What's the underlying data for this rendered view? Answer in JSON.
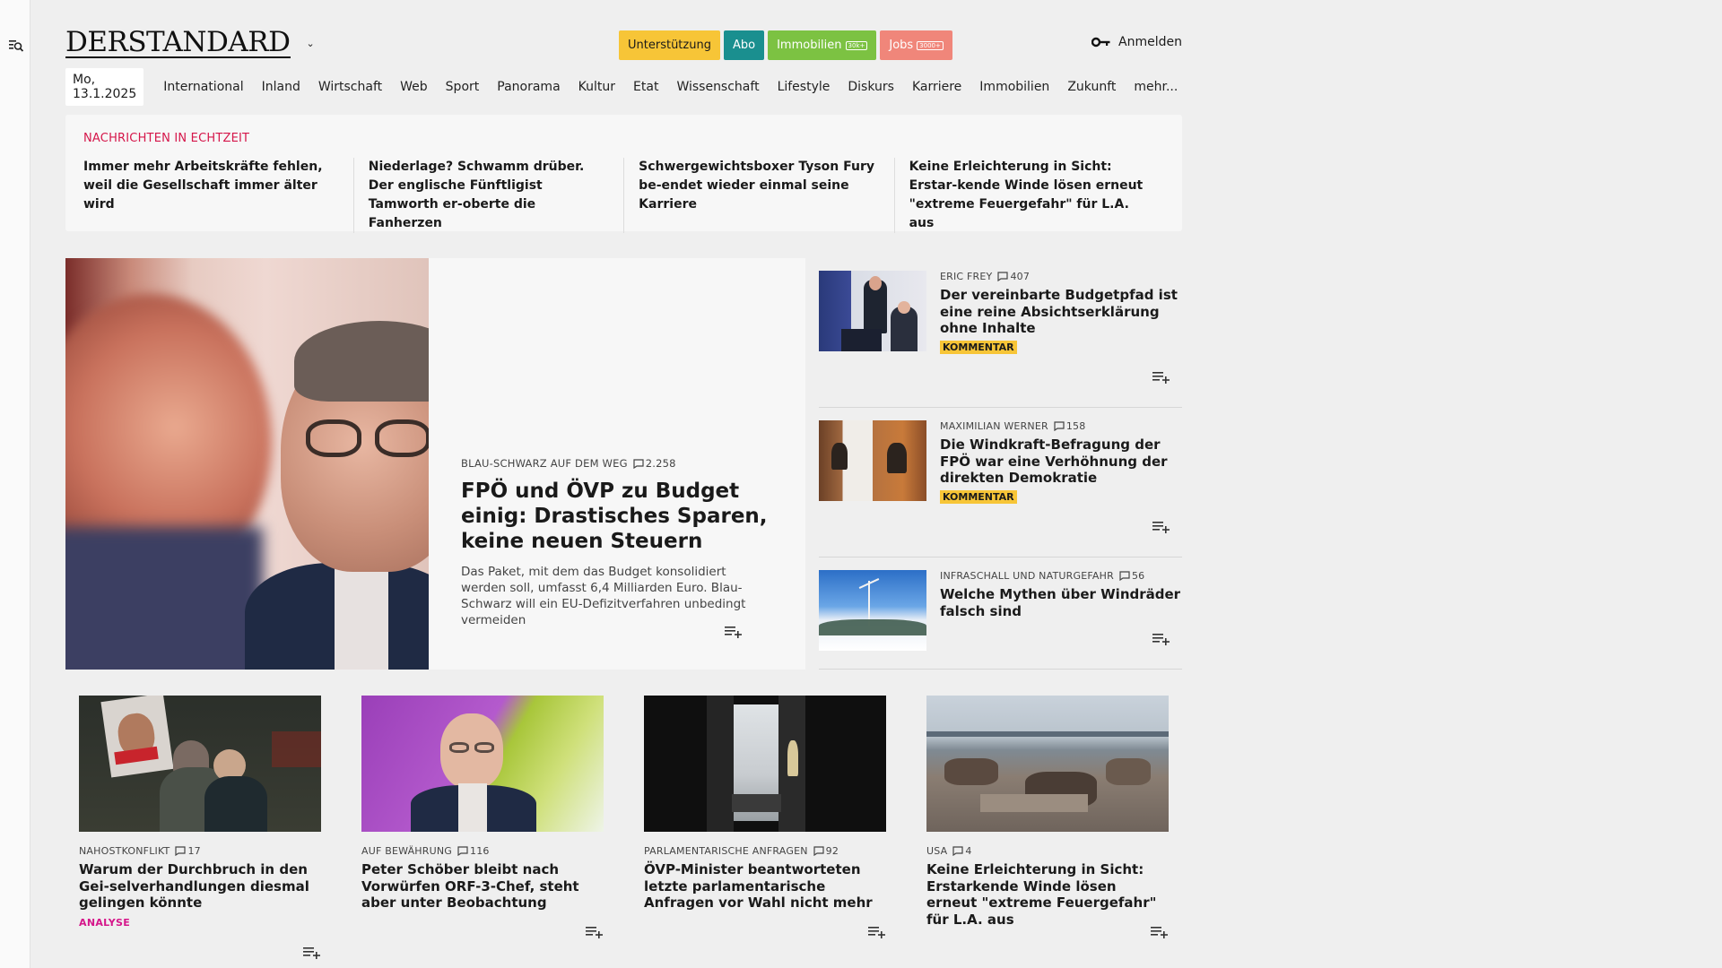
{
  "site": {
    "logo": "DERSTANDARD"
  },
  "header": {
    "badges": [
      {
        "label": "Unterstützung"
      },
      {
        "label": "Abo"
      },
      {
        "label": "Immobilien",
        "tag": "30k+"
      },
      {
        "label": "Jobs",
        "tag": "3000+"
      }
    ],
    "login_label": "Anmelden"
  },
  "nav": {
    "date": "Mo, 13.1.2025",
    "items": [
      "International",
      "Inland",
      "Wirtschaft",
      "Web",
      "Sport",
      "Panorama",
      "Kultur",
      "Etat",
      "Wissenschaft",
      "Lifestyle",
      "Diskurs",
      "Karriere",
      "Immobilien",
      "Zukunft",
      "mehr..."
    ]
  },
  "ticker": {
    "label": "NACHRICHTEN IN ECHTZEIT",
    "items": [
      "Immer mehr Arbeitskräfte fehlen, weil die Gesellschaft immer älter wird",
      "Niederlage? Schwamm drüber. Der englische Fünftligist Tamworth er-oberte die Fanherzen",
      "Schwergewichtsboxer Tyson Fury be-endet wieder einmal seine Karriere",
      "Keine Erleichterung in Sicht: Erstar-kende Winde lösen erneut \"extreme Feuergefahr\" für L.A. aus"
    ]
  },
  "hero": {
    "kicker": "BLAU-SCHWARZ AUF DEM WEG",
    "comments": "2.258",
    "title": "FPÖ und ÖVP zu Budget einig: Drastisches Sparen, keine neuen Steuern",
    "teaser": "Das Paket, mit dem das Budget konsolidiert werden soll, umfasst 6,4 Milliarden Euro. Blau-Schwarz will ein EU-Defizitverfahren unbedingt vermeiden"
  },
  "side": [
    {
      "kicker": "ERIC FREY",
      "comments": "407",
      "title": "Der vereinbarte Budgetpfad ist eine reine Absichtserklärung ohne Inhalte",
      "label": "KOMMENTAR"
    },
    {
      "kicker": "MAXIMILIAN WERNER",
      "comments": "158",
      "title": "Die Windkraft-Befragung der FPÖ war eine Verhöhnung der direkten Demokratie",
      "label": "KOMMENTAR"
    },
    {
      "kicker": "INFRASCHALL UND NATURGEFAHR",
      "comments": "56",
      "title": "Welche Mythen über Windräder falsch sind"
    }
  ],
  "cards": [
    {
      "kicker": "NAHOSTKONFLIKT",
      "comments": "17",
      "title": "Warum der Durchbruch in den Gei-selverhandlungen diesmal gelingen könnte",
      "label": "ANALYSE"
    },
    {
      "kicker": "AUF BEWÄHRUNG",
      "comments": "116",
      "title": "Peter Schöber bleibt nach Vorwürfen ORF-3-Chef, steht aber unter Beobachtung"
    },
    {
      "kicker": "PARLAMENTARISCHE ANFRAGEN",
      "comments": "92",
      "title": "ÖVP-Minister beantworteten letzte parlamentarische Anfragen vor Wahl nicht mehr"
    },
    {
      "kicker": "USA",
      "comments": "4",
      "title": "Keine Erleichterung in Sicht: Erstarkende Winde lösen erneut \"extreme Feuergefahr\" für L.A. aus"
    }
  ],
  "colors": {
    "accent_red": "#d5164a",
    "kommentar": "#f7c537",
    "analyse": "#d5168a"
  }
}
